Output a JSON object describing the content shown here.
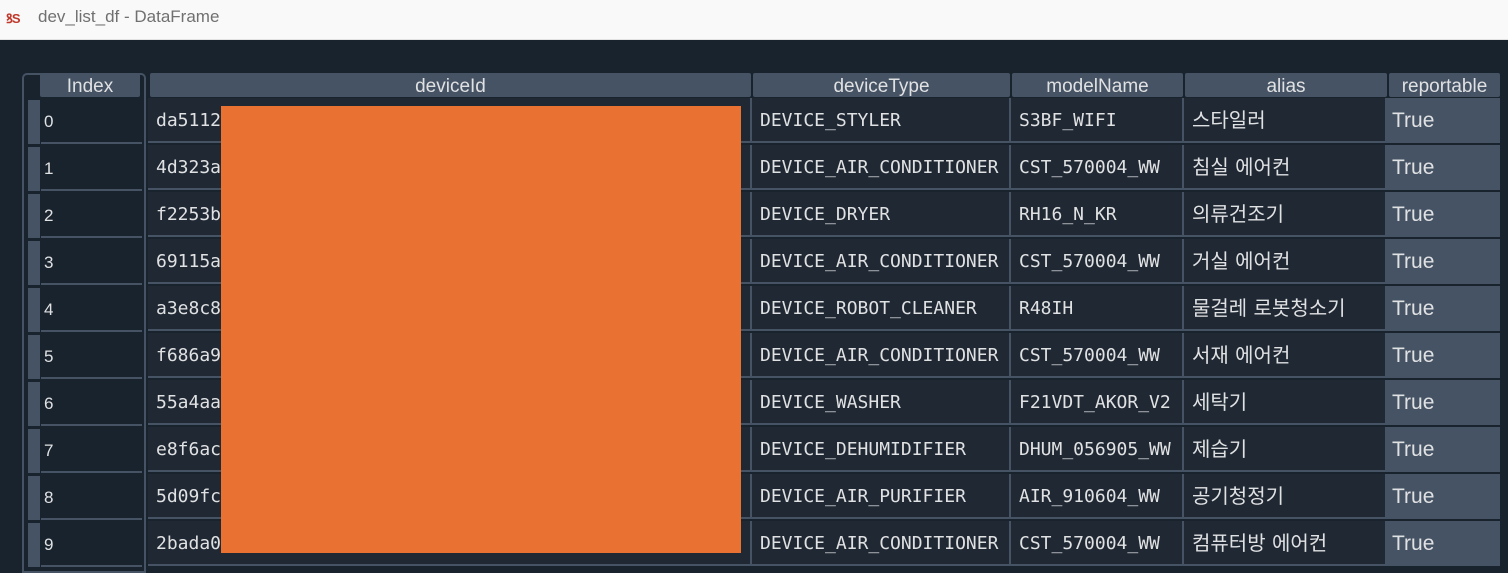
{
  "window": {
    "title": "dev_list_df - DataFrame",
    "icon": "spyder-variable-explorer-icon"
  },
  "table": {
    "columns": [
      "Index",
      "deviceId",
      "deviceType",
      "modelName",
      "alias",
      "reportable"
    ],
    "rows": [
      {
        "index": "0",
        "deviceId": "da5112",
        "deviceType": "DEVICE_STYLER",
        "modelName": "S3BF_WIFI",
        "alias": "스타일러",
        "reportable": "True"
      },
      {
        "index": "1",
        "deviceId": "4d323a",
        "deviceType": "DEVICE_AIR_CONDITIONER",
        "modelName": "CST_570004_WW",
        "alias": "침실 에어컨",
        "reportable": "True"
      },
      {
        "index": "2",
        "deviceId": "f2253b",
        "deviceType": "DEVICE_DRYER",
        "modelName": "RH16_N_KR",
        "alias": "의류건조기",
        "reportable": "True"
      },
      {
        "index": "3",
        "deviceId": "69115a",
        "deviceType": "DEVICE_AIR_CONDITIONER",
        "modelName": "CST_570004_WW",
        "alias": "거실 에어컨",
        "reportable": "True"
      },
      {
        "index": "4",
        "deviceId": "a3e8c8",
        "deviceType": "DEVICE_ROBOT_CLEANER",
        "modelName": "R48IH",
        "alias": "물걸레 로봇청소기",
        "reportable": "True"
      },
      {
        "index": "5",
        "deviceId": "f686a9",
        "deviceType": "DEVICE_AIR_CONDITIONER",
        "modelName": "CST_570004_WW",
        "alias": "서재 에어컨",
        "reportable": "True"
      },
      {
        "index": "6",
        "deviceId": "55a4aa",
        "deviceType": "DEVICE_WASHER",
        "modelName": "F21VDT_AKOR_V2",
        "alias": "세탁기",
        "reportable": "True"
      },
      {
        "index": "7",
        "deviceId": "e8f6ac",
        "deviceType": "DEVICE_DEHUMIDIFIER",
        "modelName": "DHUM_056905_WW",
        "alias": "제습기",
        "reportable": "True"
      },
      {
        "index": "8",
        "deviceId": "5d09fc",
        "deviceType": "DEVICE_AIR_PURIFIER",
        "modelName": "AIR_910604_WW",
        "alias": "공기청정기",
        "reportable": "True"
      },
      {
        "index": "9",
        "deviceId": "2bada0",
        "deviceType": "DEVICE_AIR_CONDITIONER",
        "modelName": "CST_570004_WW",
        "alias": "컴퓨터방 에어컨",
        "reportable": "True"
      }
    ]
  },
  "colors": {
    "background": "#19232d",
    "header": "#455364",
    "text": "#e0e1e3",
    "redaction": "#e97132"
  }
}
